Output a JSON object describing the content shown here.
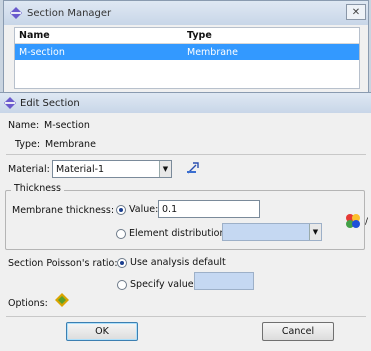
{
  "manager": {
    "title": "Section Manager",
    "close_label": "✕",
    "columns": [
      "Name",
      "Type"
    ],
    "rows": [
      {
        "name": "M-section",
        "type": "Membrane"
      }
    ]
  },
  "editor": {
    "title": "Edit Section",
    "name_label": "Name:",
    "name_value": "M-section",
    "type_label": "Type:",
    "type_value": "Membrane",
    "material_label": "Material:",
    "material_value": "Material-1",
    "thickness_group": "Thickness",
    "membrane_thickness_label": "Membrane thickness:",
    "value_option": "Value:",
    "value_input": "0.1",
    "element_distribution_option": "Element distribution:",
    "poisson_label": "Section Poisson's ratio:",
    "use_default_option": "Use analysis default",
    "specify_value_option": "Specify value:",
    "options_label": "Options:",
    "ok_label": "OK",
    "cancel_label": "Cancel",
    "side_label": "/"
  },
  "colors": {
    "selection": "#3399ff",
    "field_disabled": "#c5d8f2"
  }
}
